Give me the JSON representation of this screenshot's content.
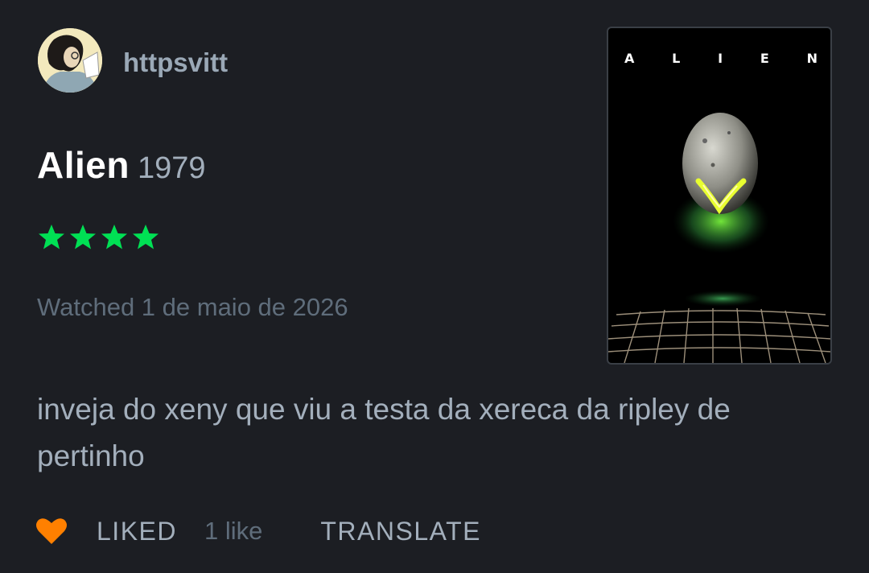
{
  "user": {
    "username": "httpsvitt",
    "avatar_icon": "user-avatar"
  },
  "movie": {
    "title": "Alien",
    "year": "1979",
    "rating": 4,
    "rating_max": 4,
    "star_color": "#00e054",
    "poster": {
      "title_letters": [
        "A",
        "L",
        "I",
        "E",
        "N"
      ]
    }
  },
  "watched": "Watched 1 de maio de 2026",
  "review": {
    "text": "inveja do xeny que viu a testa da xereca da ripley de pertinho"
  },
  "actions": {
    "heart_icon": "heart-icon",
    "heart_color": "#ff8000",
    "liked_label": "LIKED",
    "like_count": "1 like",
    "translate_label": "TRANSLATE"
  }
}
